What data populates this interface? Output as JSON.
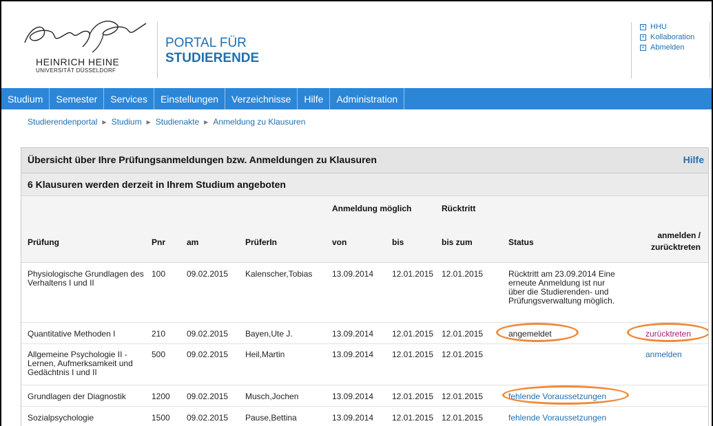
{
  "university": {
    "name": "HEINRICH HEINE",
    "subtitle": "UNIVERSITÄT DÜSSELDORF"
  },
  "portal": {
    "line1": "PORTAL FÜR",
    "line2": "STUDIERENDE"
  },
  "toplinks": [
    {
      "label": "HHU",
      "icon": "plus-box-icon"
    },
    {
      "label": "Kollaboration",
      "icon": "plus-box-icon"
    },
    {
      "label": "Abmelden",
      "icon": "plus-box-icon"
    }
  ],
  "nav": [
    "Studium",
    "Semester",
    "Services",
    "Einstellungen",
    "Verzeichnisse",
    "Hilfe",
    "Administration"
  ],
  "breadcrumb": [
    "Studierendenportal",
    "Studium",
    "Studienakte",
    "Anmeldung zu Klausuren"
  ],
  "panel": {
    "title": "Übersicht über Ihre Prüfungsanmeldungen bzw. Anmeldungen zu Klausuren",
    "help": "Hilfe",
    "subtitle": "6 Klausuren werden derzeit in Ihrem Studium angeboten"
  },
  "table": {
    "group_headers": {
      "anmeldung": "Anmeldung möglich",
      "ruecktritt": "Rücktritt"
    },
    "headers": {
      "pruefung": "Prüfung",
      "pnr": "Pnr",
      "am": "am",
      "prueferin": "PrüferIn",
      "von": "von",
      "bis": "bis",
      "bis_zum": "bis zum",
      "status": "Status",
      "action_1": "anmelden /",
      "action_2": "zurücktreten"
    },
    "rows": [
      {
        "pruefung": "Physiologische Grundlagen des Verhaltens I und II",
        "pnr": "100",
        "am": "09.02.2015",
        "prueferin": "Kalenscher,Tobias",
        "von": "13.09.2014",
        "bis": "12.01.2015",
        "bis_zum": "12.01.2015",
        "status": "Rücktritt am 23.09.2014 Eine erneute Anmeldung ist nur über die Studierenden- und Prüfungsverwaltung möglich.",
        "action": ""
      },
      {
        "pruefung": "Quantitative Methoden I",
        "pnr": "210",
        "am": "09.02.2015",
        "prueferin": "Bayen,Ute J.",
        "von": "13.09.2014",
        "bis": "12.01.2015",
        "bis_zum": "12.01.2015",
        "status": "angemeldet",
        "action": "zurücktreten"
      },
      {
        "pruefung": "Allgemeine Psychologie II - Lernen, Aufmerksamkeit und Gedächtnis I und II",
        "pnr": "500",
        "am": "09.02.2015",
        "prueferin": "Heil,Martin",
        "von": "13.09.2014",
        "bis": "12.01.2015",
        "bis_zum": "12.01.2015",
        "status": "",
        "action": "anmelden"
      },
      {
        "pruefung": "Grundlagen der Diagnostik",
        "pnr": "1200",
        "am": "09.02.2015",
        "prueferin": "Musch,Jochen",
        "von": "13.09.2014",
        "bis": "12.01.2015",
        "bis_zum": "12.01.2015",
        "status": "fehlende Voraussetzungen",
        "action": ""
      },
      {
        "pruefung": "Sozialpsychologie",
        "pnr": "1500",
        "am": "09.02.2015",
        "prueferin": "Pause,Bettina",
        "von": "13.09.2014",
        "bis": "12.01.2015",
        "bis_zum": "12.01.2015",
        "status": "fehlende Voraussetzungen",
        "action": ""
      }
    ]
  },
  "colors": {
    "nav_bg": "#2c86d8",
    "link": "#1f6fb2",
    "link_purple": "#b0187a",
    "highlight_ellipse": "#f08a38"
  }
}
